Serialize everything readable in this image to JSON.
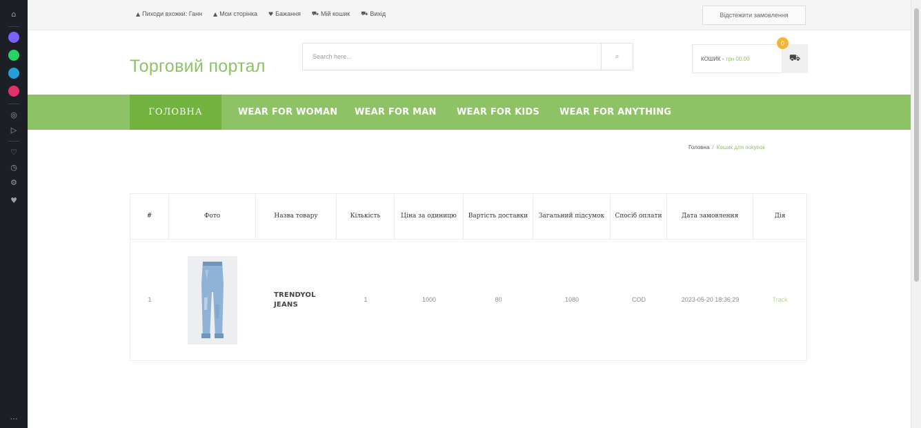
{
  "topbar": {
    "links": [
      {
        "icon": "user-icon",
        "label": "Пиходи вхожки: Ганн"
      },
      {
        "icon": "user-icon",
        "label": "Мои сторінка"
      },
      {
        "icon": "heart-icon",
        "label": "Бажання"
      },
      {
        "icon": "cart-icon",
        "label": "Мій кошик"
      },
      {
        "icon": "cart-icon",
        "label": "Вихід"
      }
    ],
    "right_button": "Відстежити замовлення"
  },
  "header": {
    "logo": "Торговий портал",
    "search_placeholder": "Search here...",
    "cart_label": "КОШИК -",
    "cart_total": "грн 00.00",
    "cart_count": "0"
  },
  "nav": {
    "items": [
      "ГОЛОВНА",
      "WEAR FOR WOMAN",
      "WEAR FOR MAN",
      "WEAR FOR KIDS",
      "WEAR FOR ANYTHING"
    ],
    "active_index": 0
  },
  "breadcrumb": {
    "home": "Головна",
    "separator": "/",
    "current": "Кошик для покупок"
  },
  "table": {
    "columns": [
      "#",
      "Фото",
      "Назва товару",
      "Кількість",
      "Ціна за одиницю",
      "Вартість доставки",
      "Загальний підсумок",
      "Спосіб оплати",
      "Дата замовлення",
      "Дія"
    ],
    "rows": [
      {
        "index": "1",
        "photo_icon": "jeans-product-photo",
        "name": "TRENDYOL JEANS",
        "quantity": "1",
        "unit_price": "1000",
        "shipping": "80",
        "total": "1080",
        "payment": "COD",
        "date": "2023-05-20 18:36:29",
        "action": "Track"
      }
    ]
  },
  "colors": {
    "accent": "#8dc365",
    "accent_dark": "#72b23e",
    "badge": "#f6b530",
    "sidebar": "#1c1f26"
  }
}
